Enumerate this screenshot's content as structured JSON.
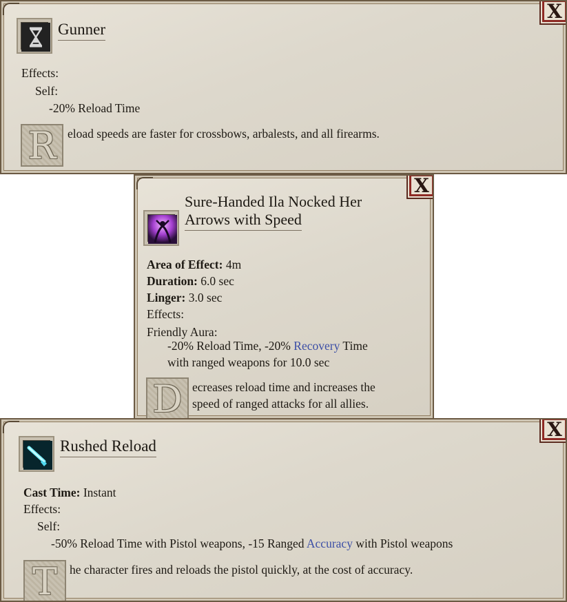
{
  "panels": [
    {
      "close_label": "X",
      "icon": "hourglass-icon",
      "title": "Gunner",
      "effects_label": "Effects:",
      "self_label": "Self:",
      "effect_line": "-20% Reload Time",
      "dropcap": "R",
      "description": "eload speeds are faster for crossbows, arbalests, and all firearms."
    },
    {
      "close_label": "X",
      "icon": "archer-aura-icon",
      "title_line1": "Sure-Handed Ila Nocked Her",
      "title_line2": "Arrows with Speed",
      "aoe_label": "Area of Effect:",
      "aoe_value": "4m",
      "duration_label": "Duration:",
      "duration_value": "6.0 sec",
      "linger_label": "Linger:",
      "linger_value": "3.0 sec",
      "effects_label": "Effects:",
      "aura_label": "Friendly Aura:",
      "effect_part1": "-20% Reload Time, -20%",
      "effect_keyword": "Recovery",
      "effect_part2": "Time",
      "effect_line2": "with ranged weapons for 10.0 sec",
      "dropcap": "D",
      "description_line1": "ecreases reload time and increases the",
      "description_line2": "speed of ranged attacks for all allies."
    },
    {
      "close_label": "X",
      "icon": "pistol-icon",
      "title": "Rushed Reload",
      "cast_time_label": "Cast Time:",
      "cast_time_value": "Instant",
      "effects_label": "Effects:",
      "self_label": "Self:",
      "effect_part1": "-50% Reload Time with Pistol weapons, -15 Ranged",
      "effect_keyword": "Accuracy",
      "effect_part2": "with Pistol weapons",
      "dropcap": "T",
      "description": "he character fires and reloads the pistol quickly, at the cost of accuracy."
    }
  ],
  "colors": {
    "parchment": "#ddd8cc",
    "frame": "#6b5a44",
    "close_border": "#8e2a24",
    "keyword": "#3c4fa6"
  }
}
